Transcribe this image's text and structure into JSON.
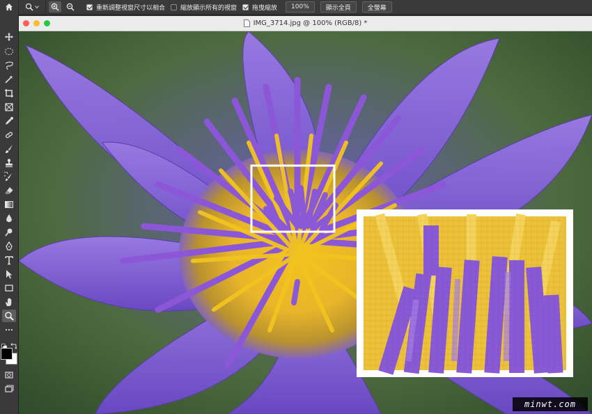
{
  "options_bar": {
    "icons": [
      "home-icon",
      "zoom-tool-icon",
      "zoom-in-icon",
      "zoom-out-icon"
    ],
    "checkboxes": [
      {
        "label": "重新調整視窗尺寸以相合",
        "checked": true
      },
      {
        "label": "縮放顯示所有的視窗",
        "checked": false
      },
      {
        "label": "拖曳縮放",
        "checked": true
      }
    ],
    "zoom_value": "100%",
    "fit_screen_label": "顯示全頁",
    "fill_screen_label": "全螢幕"
  },
  "tools_panel": {
    "tools": [
      "move-icon",
      "marquee-icon",
      "lasso-icon",
      "magic-wand-icon",
      "crop-icon",
      "frame-icon",
      "eyedropper-icon",
      "healing-brush-icon",
      "brush-icon",
      "stamp-icon",
      "history-brush-icon",
      "eraser-icon",
      "gradient-icon",
      "blur-icon",
      "dodge-icon",
      "pen-icon",
      "type-icon",
      "path-selection-icon",
      "rectangle-icon",
      "hand-icon",
      "zoom-icon",
      "more-tools-icon",
      "default-colors-icon",
      "swap-colors-icon",
      "foreground-color",
      "background-color",
      "quick-mask-icon",
      "screen-mode-icon"
    ],
    "selected_tool": "zoom-icon",
    "foreground_color": "#000000",
    "background_color": "#ffffff"
  },
  "document": {
    "title": "IMG_3714.jpg @ 100% (RGB/8) *",
    "traffic_lights": {
      "close": "#fe5f57",
      "minimize": "#febc2e",
      "zoom": "#28c840"
    }
  },
  "watermark": "minwt.com",
  "colors": {
    "petal": "#7b5bd4",
    "stamen_yellow": "#f2c41f",
    "stamen_purple": "#8a5ad6",
    "leaf": "#3f6b3a"
  }
}
